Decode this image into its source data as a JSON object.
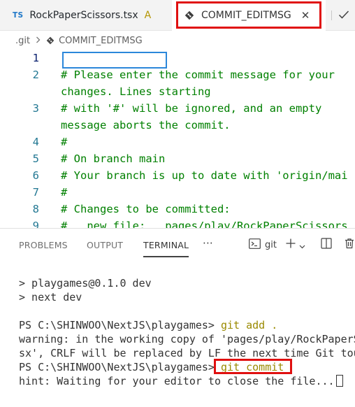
{
  "tabs": [
    {
      "badge": "TS",
      "name": "RockPaperScissors.tsx",
      "status": "A"
    },
    {
      "name": "COMMIT_EDITMSG",
      "close": "✕"
    }
  ],
  "breadcrumb": {
    "folder": ".git",
    "file": "COMMIT_EDITMSG"
  },
  "editor": {
    "lines": [
      {
        "num": "1",
        "text": ""
      },
      {
        "num": "2",
        "text": "# Please enter the commit message for your"
      },
      {
        "num": "",
        "text": "changes. Lines starting"
      },
      {
        "num": "3",
        "text": "# with '#' will be ignored, and an empty"
      },
      {
        "num": "",
        "text": "message aborts the commit."
      },
      {
        "num": "4",
        "text": "#"
      },
      {
        "num": "5",
        "text": "# On branch main"
      },
      {
        "num": "6",
        "text": "# Your branch is up to date with 'origin/mai"
      },
      {
        "num": "7",
        "text": "#"
      },
      {
        "num": "8",
        "text": "# Changes to be committed:"
      },
      {
        "num": "9",
        "text": "#   new file:   pages/play/RockPaperScissors"
      }
    ]
  },
  "panel": {
    "tabs": [
      "PROBLEMS",
      "OUTPUT",
      "TERMINAL"
    ],
    "more": "···",
    "terminal_name": "git",
    "plus": "+"
  },
  "terminal": {
    "lines": [
      "> playgames@0.1.0 dev",
      "> next dev",
      "",
      {
        "prompt": "PS C:\\SHINWOO\\NextJS\\playgames> ",
        "cmd": "git add ."
      },
      "warning: in the working copy of 'pages/play/RockPaperS",
      "sx', CRLF will be replaced by LF the next time Git tou",
      {
        "prompt": "PS C:\\SHINWOO\\NextJS\\playgames> ",
        "cmd": "git commit"
      },
      "hint: Waiting for your editor to close the file... "
    ],
    "l0": "> playgames@0.1.0 dev",
    "l1": "> next dev",
    "l3_prompt": "PS C:\\SHINWOO\\NextJS\\playgames> ",
    "l3_cmd": "git add .",
    "l4": "warning: in the working copy of 'pages/play/RockPaperS",
    "l5": "sx', CRLF will be replaced by LF the next time Git tou",
    "l6_prompt": "PS C:\\SHINWOO\\NextJS\\playgames>",
    "l6_cmd": "git commit",
    "l7": "hint: Waiting for your editor to close the file..."
  },
  "colors": {
    "comment": "#008000",
    "linenum": "#237893",
    "highlight_red": "#e01010",
    "highlight_blue": "#2b87da",
    "ts_blue": "#1f78c8"
  }
}
